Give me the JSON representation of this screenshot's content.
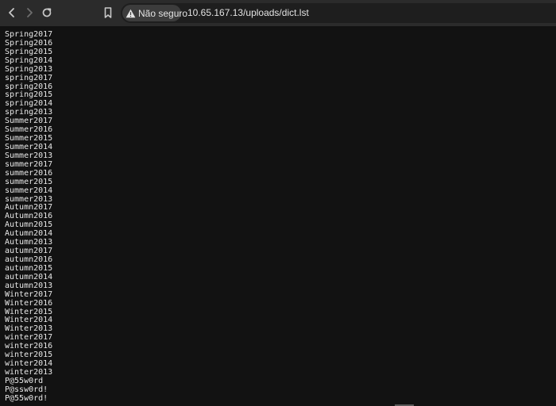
{
  "browser": {
    "security_label": "Não seguro",
    "url": "10.65.167.13/uploads/dict.lst",
    "icons": {
      "back": "arrow-left-icon",
      "forward": "arrow-right-icon",
      "reload": "reload-icon",
      "bookmark": "bookmark-icon",
      "warning": "warning-triangle-icon"
    }
  },
  "document": {
    "lines": [
      "Spring2017",
      "Spring2016",
      "Spring2015",
      "Spring2014",
      "Spring2013",
      "spring2017",
      "spring2016",
      "spring2015",
      "spring2014",
      "spring2013",
      "Summer2017",
      "Summer2016",
      "Summer2015",
      "Summer2014",
      "Summer2013",
      "summer2017",
      "summer2016",
      "summer2015",
      "summer2014",
      "summer2013",
      "Autumn2017",
      "Autumn2016",
      "Autumn2015",
      "Autumn2014",
      "Autumn2013",
      "autumn2017",
      "autumn2016",
      "autumn2015",
      "autumn2014",
      "autumn2013",
      "Winter2017",
      "Winter2016",
      "Winter2015",
      "Winter2014",
      "Winter2013",
      "winter2017",
      "winter2016",
      "winter2015",
      "winter2014",
      "winter2013",
      "P@55w0rd",
      "P@ssw0rd!",
      "P@55w0rd!"
    ]
  }
}
